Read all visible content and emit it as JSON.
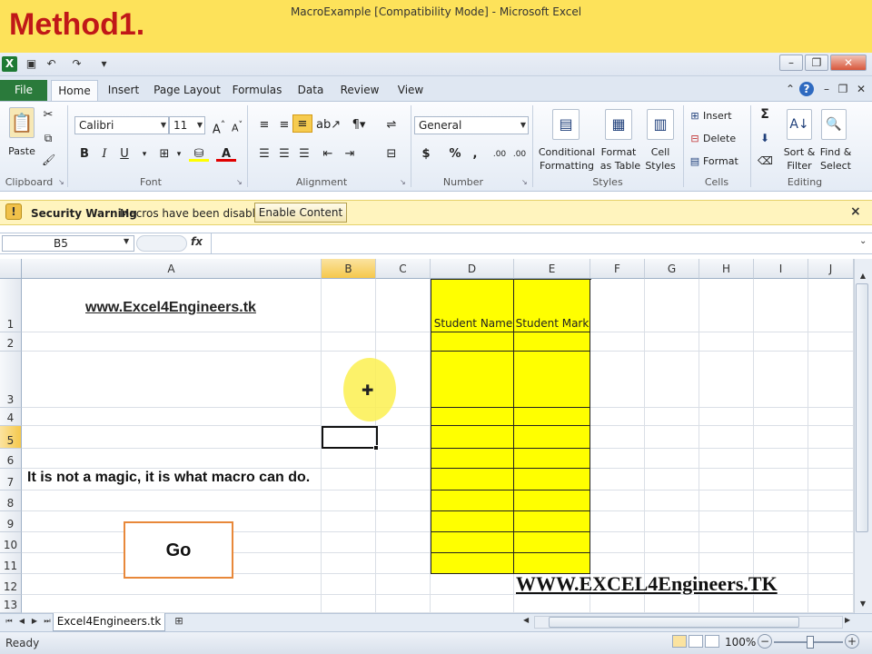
{
  "banner": {
    "title": "Method1."
  },
  "window": {
    "title": "MacroExample  [Compatibility Mode]  -  Microsoft Excel"
  },
  "ribbon_tabs": [
    "File",
    "Home",
    "Insert",
    "Page Layout",
    "Formulas",
    "Data",
    "Review",
    "View"
  ],
  "active_tab": "Home",
  "ribbon": {
    "clipboard": {
      "paste": "Paste",
      "label": "Clipboard"
    },
    "font": {
      "name": "Calibri",
      "size": "11",
      "bold": "B",
      "italic": "I",
      "underline": "U",
      "label": "Font"
    },
    "alignment": {
      "label": "Alignment"
    },
    "number": {
      "format": "General",
      "dollar": "$",
      "percent": "%",
      "comma": ",",
      "inc_decimal": ".00",
      "dec_decimal": ".00",
      "label": "Number"
    },
    "styles": {
      "conditional_1": "Conditional",
      "conditional_2": "Formatting",
      "format_table_1": "Format",
      "format_table_2": "as Table",
      "cell_styles_1": "Cell",
      "cell_styles_2": "Styles",
      "label": "Styles"
    },
    "cells": {
      "insert": "Insert",
      "delete": "Delete",
      "format": "Format",
      "label": "Cells"
    },
    "editing": {
      "sort_1": "Sort &",
      "sort_2": "Filter",
      "find_1": "Find &",
      "find_2": "Select",
      "label": "Editing"
    }
  },
  "security_bar": {
    "title": "Security Warning",
    "message": "Macros have been disabled.",
    "button": "Enable Content",
    "icon": "!",
    "close": "×"
  },
  "formula_bar": {
    "name_box": "B5",
    "fx": "fx",
    "value": ""
  },
  "columns": [
    "A",
    "B",
    "C",
    "D",
    "E",
    "F",
    "G",
    "H",
    "I",
    "J"
  ],
  "rows": [
    "1",
    "2",
    "3",
    "4",
    "5",
    "6",
    "7",
    "8",
    "9",
    "10",
    "11",
    "12",
    "13"
  ],
  "selected_cell": {
    "column": "B",
    "row": "5"
  },
  "cells": {
    "A1": "www.Excel4Engineers.tk",
    "D1": "Student Name",
    "E1": "Student Mark",
    "A7": "It is not a magic, it is what macro can do."
  },
  "go_button": "Go",
  "watermark": "WWW.EXCEL4Engineers.TK",
  "sheet_tabs": [
    "Excel4Engineers.tk"
  ],
  "status": {
    "ready": "Ready",
    "zoom": "100%",
    "zoom_minus": "−",
    "zoom_plus": "+"
  },
  "colors": {
    "banner": "#fde25a",
    "banner_title": "#c01818",
    "highlight": "#ffff00",
    "file_tab": "#2a7a3b",
    "go_border": "#e8883a"
  }
}
